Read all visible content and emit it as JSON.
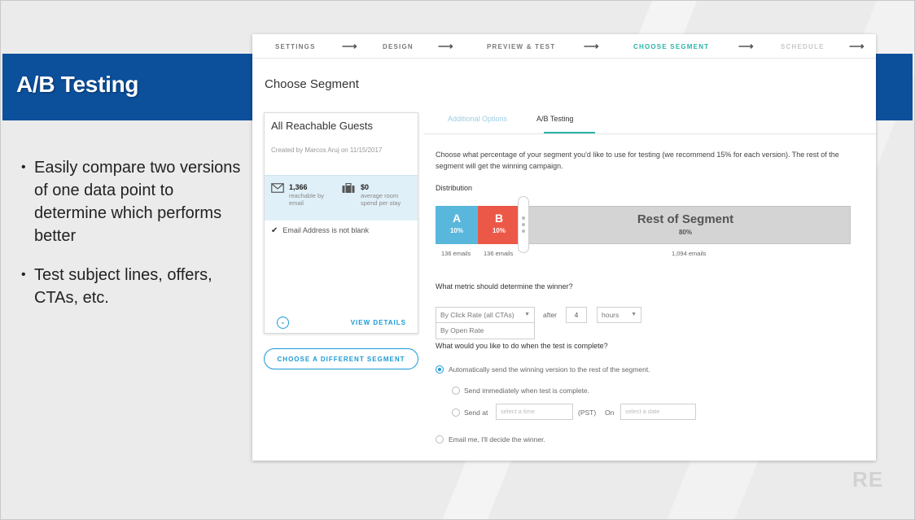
{
  "slide": {
    "title": "A/B Testing",
    "bullets": [
      "Easily compare two versions of one data point to determine which performs better",
      "Test subject lines, offers, CTAs, etc."
    ],
    "logo_text": "RE"
  },
  "stepper": {
    "steps": [
      {
        "label": "SETTINGS",
        "state": "done"
      },
      {
        "label": "DESIGN",
        "state": "done"
      },
      {
        "label": "PREVIEW & TEST",
        "state": "done"
      },
      {
        "label": "CHOOSE SEGMENT",
        "state": "active"
      },
      {
        "label": "SCHEDULE",
        "state": "disabled"
      }
    ],
    "arrow_glyph": "⟶"
  },
  "page": {
    "title": "Choose Segment"
  },
  "segment_card": {
    "name": "All Reachable Guests",
    "created": "Created by Marcos Aruj on 11/15/2017",
    "stats": [
      {
        "icon": "envelope-icon",
        "value": "1,366",
        "label": "reachable by email"
      },
      {
        "icon": "briefcase-icon",
        "value": "$0",
        "label": "average room spend per stay"
      }
    ],
    "rule": "Email Address is not blank",
    "view_details": "VIEW DETAILS",
    "expand_glyph": "⌄"
  },
  "choose_button": "CHOOSE A DIFFERENT SEGMENT",
  "tabs": [
    {
      "label": "Additional Options",
      "active": false
    },
    {
      "label": "A/B Testing",
      "active": true
    }
  ],
  "ab": {
    "intro": "Choose what percentage of your segment you'd like to use for testing (we recommend 15% for each version). The rest of the segment will get the winning campaign.",
    "distribution_label": "Distribution",
    "segments": [
      {
        "name": "A",
        "pct": "10%",
        "emails": "136 emails",
        "color": "#5ab7dc"
      },
      {
        "name": "B",
        "pct": "10%",
        "emails": "136 emails",
        "color": "#ec5847"
      },
      {
        "name": "Rest of Segment",
        "pct": "80%",
        "emails": "1,094 emails",
        "color": "#d4d4d4"
      }
    ],
    "metric_question": "What metric should determine the winner?",
    "metric_selected": "By Click Rate (all CTAs)",
    "metric_option_open": "By Open Rate",
    "after_label": "after",
    "duration_value": "4",
    "duration_unit": "hours",
    "complete_question": "What would you like to do when the test is complete?",
    "options": {
      "auto": "Automatically send the winning version to the rest of the segment.",
      "immediately": "Send immediately when test is complete.",
      "send_at": "Send at",
      "time_placeholder": "select a time",
      "tz": "(PST)",
      "on": "On",
      "date_placeholder": "select a date",
      "email_me": "Email me, I'll decide the winner."
    }
  }
}
